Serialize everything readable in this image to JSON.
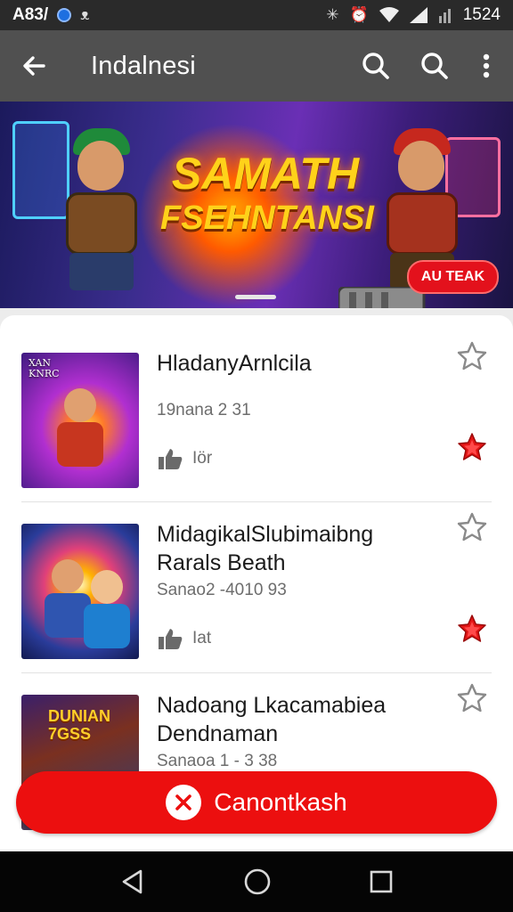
{
  "status_bar": {
    "left_text": "A83/",
    "left_glyph": "ᴥ",
    "time": "1524",
    "right_glyph_1": "✳",
    "right_glyph_2": "⏰"
  },
  "app_bar": {
    "title": "Indalnesi",
    "icons": [
      "back-arrow-icon",
      "search-icon",
      "search-icon",
      "more-vert-icon"
    ]
  },
  "banner": {
    "title_line_1": "SAMATH",
    "title_line_2": "FSEHNTANSI",
    "badge": "AU TEAK"
  },
  "games": [
    {
      "title": "HladanyArnlcila",
      "meta": "19nana 2  31",
      "likes": "Iör",
      "thumb_caption": "XAN\nKNRC",
      "favorited": true
    },
    {
      "title": "MidagikalSlubimaibng Rarals Beath",
      "meta": "Sanao2 -4010 93",
      "likes": "Iat",
      "thumb_caption": "",
      "favorited": true
    },
    {
      "title": "Nadoang Lkacamabiea Dendnaman",
      "meta": "Sanaoa 1 - 3 38",
      "likes": "",
      "thumb_caption": "DUNIAN\n7GSS",
      "favorited": false
    }
  ],
  "cta": {
    "label": "Canontkash"
  },
  "colors": {
    "accent_red": "#ec0f0f",
    "app_bar": "#505050",
    "status_bar": "#2a2a2a"
  }
}
